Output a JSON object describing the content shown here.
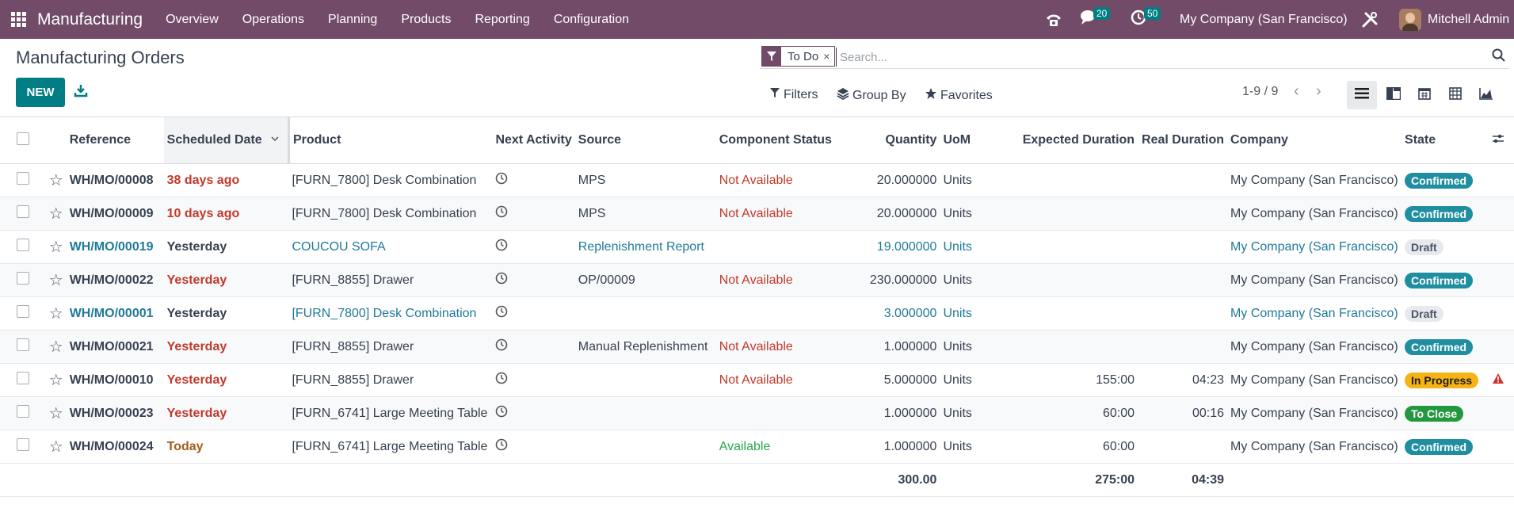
{
  "app": {
    "name": "Manufacturing",
    "menu": [
      "Overview",
      "Operations",
      "Planning",
      "Products",
      "Reporting",
      "Configuration"
    ],
    "messages_count": "20",
    "activities_count": "50",
    "company": "My Company (San Francisco)",
    "user": "Mitchell Admin"
  },
  "page": {
    "title": "Manufacturing Orders",
    "new_label": "NEW",
    "facet_label": "To Do",
    "facet_remove": "×",
    "search_placeholder": "Search...",
    "filters_label": "Filters",
    "group_by_label": "Group By",
    "favorites_label": "Favorites",
    "pager": "1-9 / 9",
    "pager_prev": "‹",
    "pager_next": "›"
  },
  "columns": [
    "Reference",
    "Scheduled Date",
    "Product",
    "Next Activity",
    "Source",
    "Component Status",
    "Quantity",
    "UoM",
    "Expected Duration",
    "Real Duration",
    "Company",
    "State"
  ],
  "rows": [
    {
      "ref": "WH/MO/00008",
      "date": "38 days ago",
      "date_color": "red",
      "product": "[FURN_7800] Desk Combination",
      "source": "MPS",
      "component": "Not Available",
      "component_color": "red",
      "qty": "20.000000",
      "uom": "Units",
      "exp": "",
      "real": "",
      "company": "My Company (San Francisco)",
      "state": "Confirmed",
      "state_cls": "confirmed",
      "draft": false,
      "warn": false
    },
    {
      "ref": "WH/MO/00009",
      "date": "10 days ago",
      "date_color": "red",
      "product": "[FURN_7800] Desk Combination",
      "source": "MPS",
      "component": "Not Available",
      "component_color": "red",
      "qty": "20.000000",
      "uom": "Units",
      "exp": "",
      "real": "",
      "company": "My Company (San Francisco)",
      "state": "Confirmed",
      "state_cls": "confirmed",
      "draft": false,
      "warn": false
    },
    {
      "ref": "WH/MO/00019",
      "date": "Yesterday",
      "date_color": "red",
      "product": "COUCOU SOFA",
      "source": "Replenishment Report",
      "component": "",
      "component_color": "",
      "qty": "19.000000",
      "uom": "Units",
      "exp": "",
      "real": "",
      "company": "My Company (San Francisco)",
      "state": "Draft",
      "state_cls": "draft",
      "draft": true,
      "warn": false
    },
    {
      "ref": "WH/MO/00022",
      "date": "Yesterday",
      "date_color": "red",
      "product": "[FURN_8855] Drawer",
      "source": "OP/00009",
      "component": "Not Available",
      "component_color": "red",
      "qty": "230.000000",
      "uom": "Units",
      "exp": "",
      "real": "",
      "company": "My Company (San Francisco)",
      "state": "Confirmed",
      "state_cls": "confirmed",
      "draft": false,
      "warn": false
    },
    {
      "ref": "WH/MO/00001",
      "date": "Yesterday",
      "date_color": "red",
      "product": "[FURN_7800] Desk Combination",
      "source": "",
      "component": "",
      "component_color": "",
      "qty": "3.000000",
      "uom": "Units",
      "exp": "",
      "real": "",
      "company": "My Company (San Francisco)",
      "state": "Draft",
      "state_cls": "draft",
      "draft": true,
      "warn": false
    },
    {
      "ref": "WH/MO/00021",
      "date": "Yesterday",
      "date_color": "red",
      "product": "[FURN_8855] Drawer",
      "source": "Manual Replenishment",
      "component": "Not Available",
      "component_color": "red",
      "qty": "1.000000",
      "uom": "Units",
      "exp": "",
      "real": "",
      "company": "My Company (San Francisco)",
      "state": "Confirmed",
      "state_cls": "confirmed",
      "draft": false,
      "warn": false
    },
    {
      "ref": "WH/MO/00010",
      "date": "Yesterday",
      "date_color": "red",
      "product": "[FURN_8855] Drawer",
      "source": "",
      "component": "Not Available",
      "component_color": "red",
      "qty": "5.000000",
      "uom": "Units",
      "exp": "155:00",
      "real": "04:23",
      "company": "My Company (San Francisco)",
      "state": "In Progress",
      "state_cls": "progress",
      "draft": false,
      "warn": true
    },
    {
      "ref": "WH/MO/00023",
      "date": "Yesterday",
      "date_color": "red",
      "product": "[FURN_6741] Large Meeting Table",
      "source": "",
      "component": "",
      "component_color": "",
      "qty": "1.000000",
      "uom": "Units",
      "exp": "60:00",
      "real": "00:16",
      "company": "My Company (San Francisco)",
      "state": "To Close",
      "state_cls": "close",
      "draft": false,
      "warn": false
    },
    {
      "ref": "WH/MO/00024",
      "date": "Today",
      "date_color": "orange",
      "product": "[FURN_6741] Large Meeting Table",
      "source": "",
      "component": "Available",
      "component_color": "green",
      "qty": "1.000000",
      "uom": "Units",
      "exp": "60:00",
      "real": "",
      "company": "My Company (San Francisco)",
      "state": "Confirmed",
      "state_cls": "confirmed",
      "draft": false,
      "warn": false
    }
  ],
  "totals": {
    "qty": "300.00",
    "exp": "275:00",
    "real": "04:39"
  }
}
